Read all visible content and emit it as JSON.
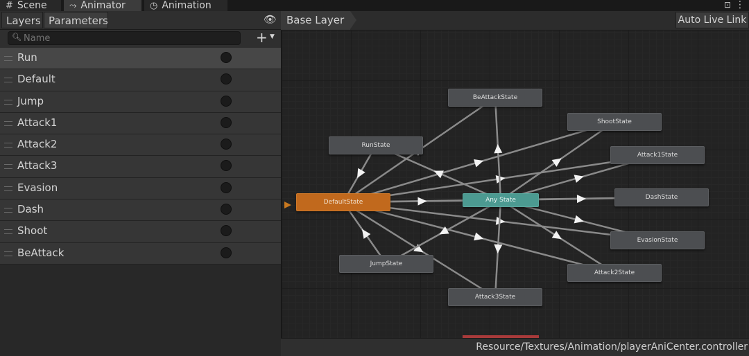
{
  "tabs": [
    {
      "label": "Scene",
      "icon": "grid-icon"
    },
    {
      "label": "Animator",
      "icon": "animator-icon"
    },
    {
      "label": "Animation",
      "icon": "clock-icon"
    }
  ],
  "left_panel": {
    "tabs": [
      "Layers",
      "Parameters"
    ],
    "search": {
      "placeholder": "Name",
      "value": ""
    },
    "parameters": [
      "Run",
      "Default",
      "Jump",
      "Attack1",
      "Attack2",
      "Attack3",
      "Evasion",
      "Dash",
      "Shoot",
      "BeAttack"
    ],
    "selected_parameter": "Run"
  },
  "graph": {
    "breadcrumb": "Base Layer",
    "live_link_label": "Auto Live Link",
    "states": {
      "be_attack": "BeAttackState",
      "shoot": "ShootState",
      "run": "RunState",
      "attack1": "Attack1State",
      "default": "DefaultState",
      "any": "Any State",
      "dash": "DashState",
      "evasion": "EvasionState",
      "jump": "JumpState",
      "attack2": "Attack2State",
      "attack3": "Attack3State"
    },
    "default_state_color": "#c1691d",
    "any_state_color": "#4c9a91"
  },
  "status_path": "Resource/Textures/Animation/playerAniCenter.controller"
}
